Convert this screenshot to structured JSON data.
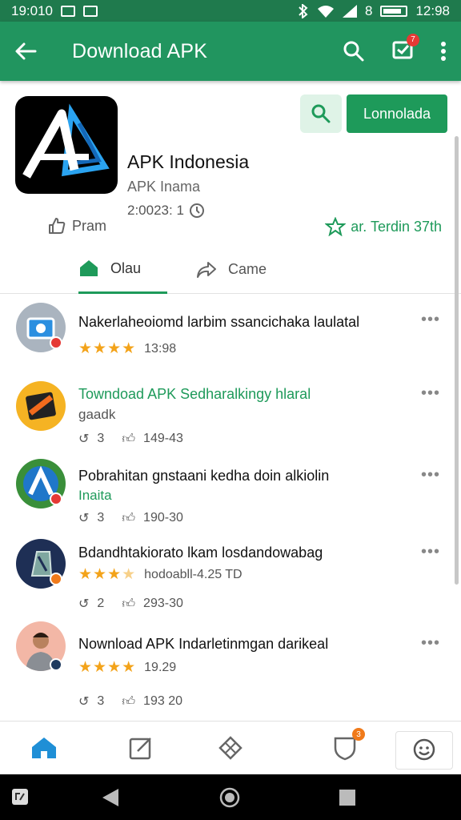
{
  "status_bar": {
    "time_left": "19:010",
    "time_right": "12:98",
    "battery_label": "8"
  },
  "app_bar": {
    "title": "Download APK",
    "notification_count": "7"
  },
  "app": {
    "name": "APK Indonesia",
    "subtitle": "APK Inama",
    "meta": "2:0023: 1",
    "download_label": "Lonnolada",
    "share_label": "Pram",
    "trending_label": "ar. Terdin 37th",
    "tabs": [
      {
        "label": "Olau"
      },
      {
        "label": "Came"
      }
    ]
  },
  "feed": [
    {
      "title": "Nakerlaheoiomd larbim ssancichaka laulatal",
      "rating_text": "13:98",
      "stars": 4
    },
    {
      "title": "Towndoad APK Sedharalkingy hlaral",
      "subtitle": "gaadk",
      "reply_count": "3",
      "like_count": "149-43"
    },
    {
      "title": "Pobrahitan gnstaani kedha doin alkiolin",
      "subtitle": "Inaita",
      "reply_count": "3",
      "like_count": "190-30"
    },
    {
      "title": "Bdandhtakiorato lkam losdandowabag",
      "rating_text": "hodoabll-4.25 TD",
      "stars": 3.5,
      "reply_count": "2",
      "like_count": "293-30"
    },
    {
      "title": "Nownload APK Indarletinmgan darikeal",
      "rating_text": "19.29",
      "stars": 4,
      "reply_count": "3",
      "like_count": "193 20"
    }
  ],
  "bottom_nav": {
    "notification_count": "3"
  },
  "colors": {
    "primary": "#21955f",
    "accent": "#1e9a5a",
    "star": "#f3a31a",
    "badge": "#e53935"
  }
}
